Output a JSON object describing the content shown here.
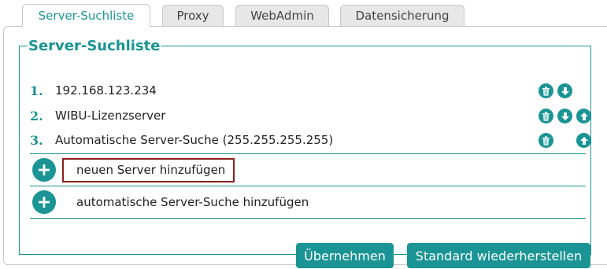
{
  "tabs": [
    {
      "label": "Server-Suchliste",
      "active": true
    },
    {
      "label": "Proxy",
      "active": false
    },
    {
      "label": "WebAdmin",
      "active": false
    },
    {
      "label": "Datensicherung",
      "active": false
    }
  ],
  "section": {
    "title": "Server-Suchliste"
  },
  "servers": [
    {
      "num": "1.",
      "name": "192.168.123.234"
    },
    {
      "num": "2.",
      "name": "WIBU-Lizenzserver"
    },
    {
      "num": "3.",
      "name": "Automatische Server-Suche (255.255.255.255)"
    }
  ],
  "add": {
    "server_label": "neuen Server hinzufügen",
    "auto_label": "automatische Server-Suche hinzufügen"
  },
  "buttons": {
    "apply": "Übernehmen",
    "reset": "Standard wiederherstellen"
  },
  "colors": {
    "accent": "#1a9494",
    "highlight_border": "#8b2020"
  },
  "icons": {
    "delete": "trash-icon",
    "down": "arrow-down-icon",
    "up": "arrow-up-icon",
    "add": "plus-icon"
  }
}
